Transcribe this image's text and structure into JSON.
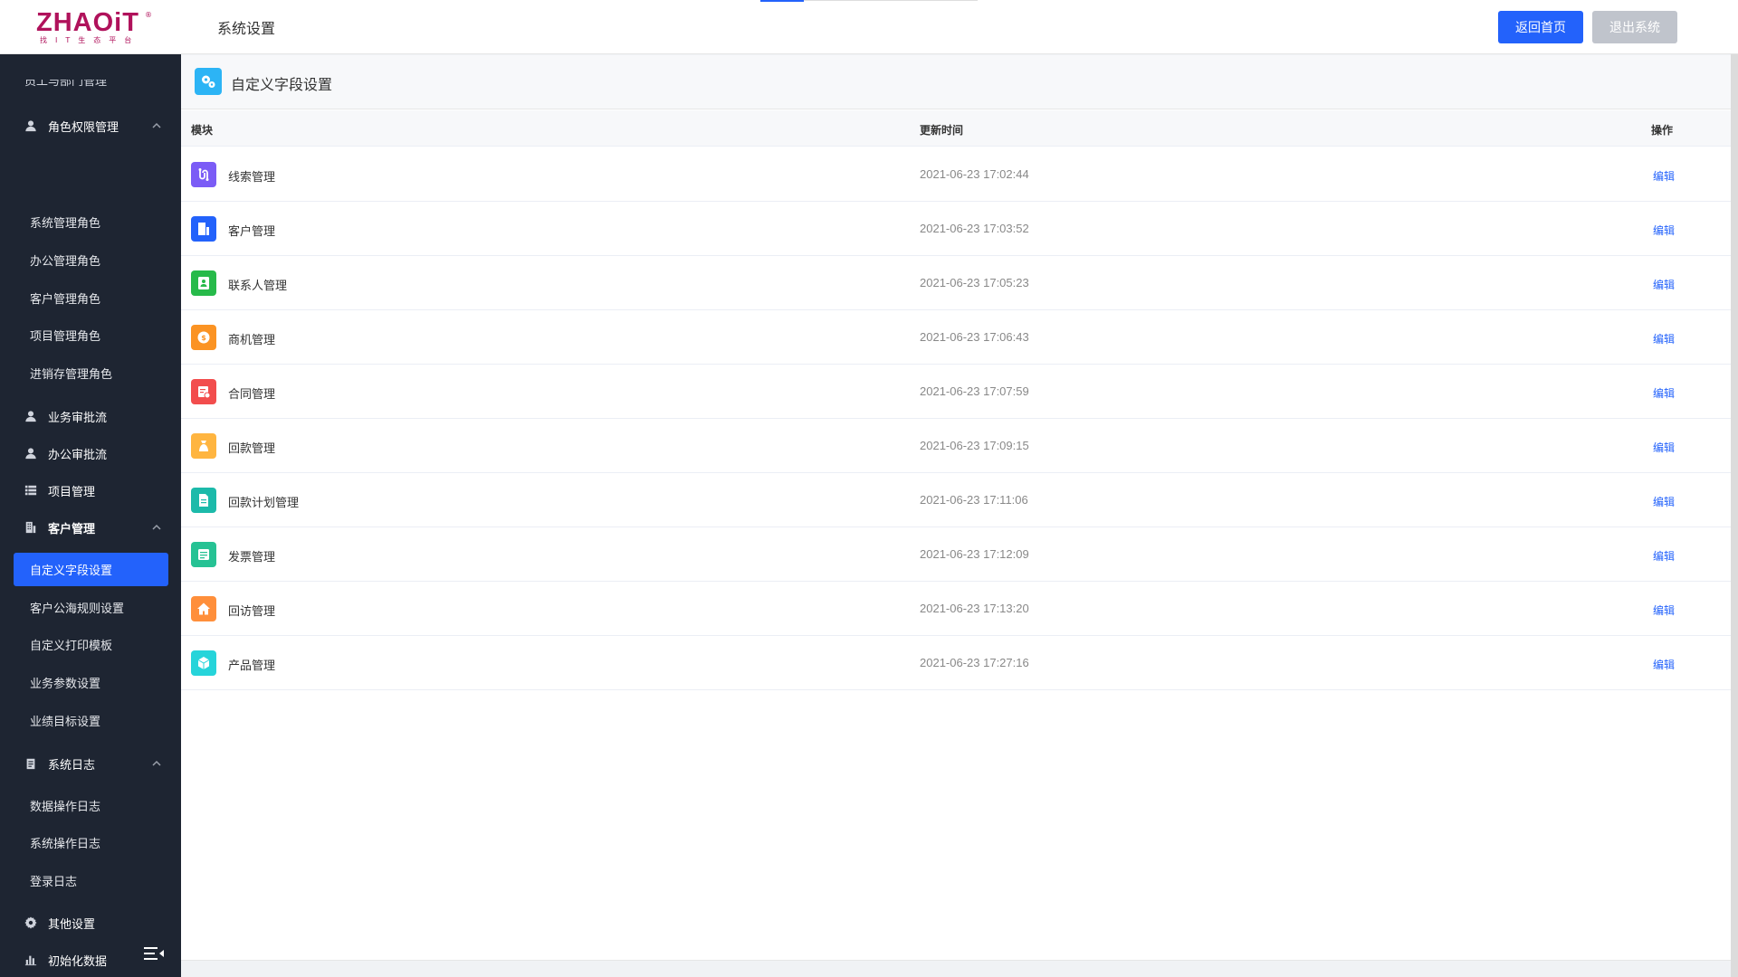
{
  "header": {
    "logo_main": "ZHAOiT",
    "logo_sub": "找IT生态平台",
    "logo_reg": "®",
    "title": "系统设置",
    "home_button": "返回首页",
    "logout_button": "退出系统"
  },
  "sidebar": {
    "cut_label": "员工与部门管理",
    "groups": {
      "role": "角色权限管理",
      "biz_flow": "业务审批流",
      "office_flow": "办公审批流",
      "project": "项目管理",
      "customer": "客户管理",
      "syslog": "系统日志",
      "other": "其他设置",
      "init": "初始化数据"
    },
    "role_items": [
      "系统管理角色",
      "办公管理角色",
      "客户管理角色",
      "项目管理角色",
      "进销存管理角色"
    ],
    "customer_items": [
      "自定义字段设置",
      "客户公海规则设置",
      "自定义打印模板",
      "业务参数设置",
      "业绩目标设置"
    ],
    "log_items": [
      "数据操作日志",
      "系统操作日志",
      "登录日志"
    ],
    "active_item": "自定义字段设置"
  },
  "content": {
    "title": "自定义字段设置",
    "columns": {
      "module": "模块",
      "time": "更新时间",
      "op": "操作"
    },
    "rows": [
      {
        "name": "线索管理",
        "time": "2021-06-23 17:02:44",
        "action": "编辑",
        "icon": "clue-icon",
        "color": "#7b5cf6"
      },
      {
        "name": "客户管理",
        "time": "2021-06-23 17:03:52",
        "action": "编辑",
        "icon": "customer-icon",
        "color": "#2362fb"
      },
      {
        "name": "联系人管理",
        "time": "2021-06-23 17:05:23",
        "action": "编辑",
        "icon": "contact-icon",
        "color": "#27ba4a"
      },
      {
        "name": "商机管理",
        "time": "2021-06-23 17:06:43",
        "action": "编辑",
        "icon": "business-icon",
        "color": "#fb9323"
      },
      {
        "name": "合同管理",
        "time": "2021-06-23 17:07:59",
        "action": "编辑",
        "icon": "contract-icon",
        "color": "#f24d4d"
      },
      {
        "name": "回款管理",
        "time": "2021-06-23 17:09:15",
        "action": "编辑",
        "icon": "money-bag-icon",
        "color": "#ffb540"
      },
      {
        "name": "回款计划管理",
        "time": "2021-06-23 17:11:06",
        "action": "编辑",
        "icon": "plan-icon",
        "color": "#1cbaaa"
      },
      {
        "name": "发票管理",
        "time": "2021-06-23 17:12:09",
        "action": "编辑",
        "icon": "invoice-icon",
        "color": "#26c294"
      },
      {
        "name": "回访管理",
        "time": "2021-06-23 17:13:20",
        "action": "编辑",
        "icon": "visit-icon",
        "color": "#ff8f3b"
      },
      {
        "name": "产品管理",
        "time": "2021-06-23 17:27:16",
        "action": "编辑",
        "icon": "product-icon",
        "color": "#26d4da"
      }
    ]
  }
}
